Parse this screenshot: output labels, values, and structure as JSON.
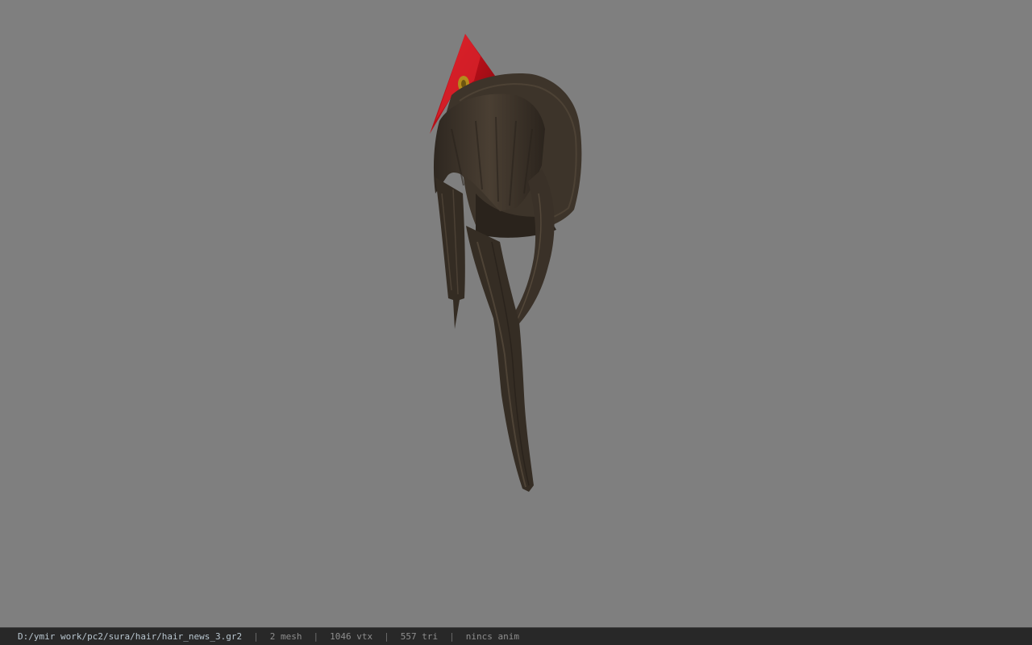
{
  "viewer": {
    "background_color": "#7f7f7f",
    "model_name": "hair_news_3",
    "hair_color": "#3a3127",
    "ornament_color": "#c0121a"
  },
  "status": {
    "file_path": "D:/ymir work/pc2/sura/hair/hair_news_3.gr2",
    "separator": "|",
    "mesh_count": "2 mesh",
    "vertex_count": "1046 vtx",
    "triangle_count": "557 tri",
    "animation": "nincs anim"
  }
}
